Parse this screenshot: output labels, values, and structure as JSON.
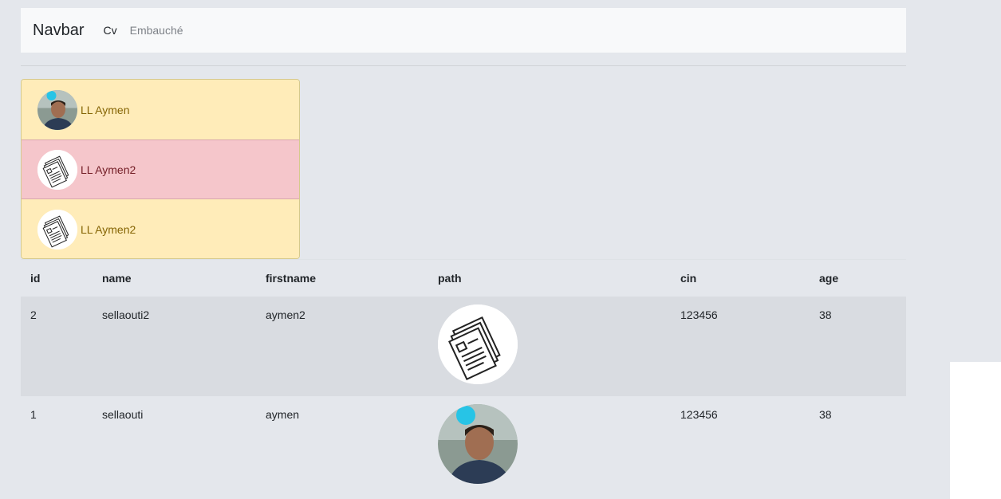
{
  "navbar": {
    "brand": "Navbar",
    "links": [
      {
        "label": "Cv"
      },
      {
        "label": "Embauché"
      }
    ]
  },
  "list": {
    "items": [
      {
        "label": "LL Aymen",
        "variant": "warning",
        "icon": "person-photo"
      },
      {
        "label": "LL Aymen2",
        "variant": "danger",
        "icon": "document-icon"
      },
      {
        "label": "LL Aymen2",
        "variant": "warning",
        "icon": "document-icon"
      }
    ]
  },
  "table": {
    "headers": [
      "id",
      "name",
      "firstname",
      "path",
      "cin",
      "age"
    ],
    "rows": [
      {
        "id": "2",
        "name": "sellaouti2",
        "firstname": "aymen2",
        "path_icon": "document-icon",
        "cin": "123456",
        "age": "38"
      },
      {
        "id": "1",
        "name": "sellaouti",
        "firstname": "aymen",
        "path_icon": "person-photo",
        "cin": "123456",
        "age": "38"
      }
    ]
  },
  "colors": {
    "background": "#e4e7ec",
    "navbar_bg": "#f8f9fa",
    "warning_bg": "#ffecb9",
    "danger_bg": "#f5c6cb",
    "striped_row": "#d9dce1"
  }
}
